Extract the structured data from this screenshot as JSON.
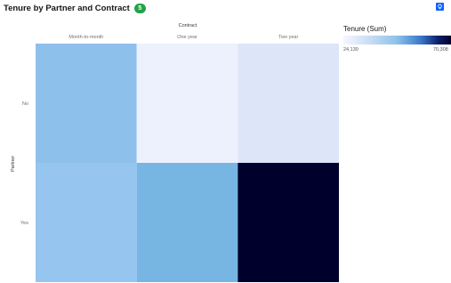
{
  "header": {
    "title": "Tenure by Partner and Contract",
    "badge": "5"
  },
  "legend": {
    "title": "Tenure (Sum)",
    "min_label": "24,130",
    "max_label": "70,308",
    "min_color": "#f6f7ff",
    "max_color": "#00002c"
  },
  "chart_data": {
    "type": "heatmap",
    "xlabel": "Contract",
    "ylabel": "Partner",
    "x_categories": [
      "Month-to-month",
      "One year",
      "Two year"
    ],
    "y_categories": [
      "No",
      "Yes"
    ],
    "values": [
      [
        52000,
        24130,
        31000
      ],
      [
        48000,
        55000,
        70308
      ]
    ],
    "cell_colors": [
      [
        "#8ec0ec",
        "#edf0fd",
        "#dde5f8"
      ],
      [
        "#96c5ef",
        "#77b5e3",
        "#00002c"
      ]
    ],
    "color_scale": {
      "label": "Tenure (Sum)",
      "range": [
        24130,
        70308
      ]
    }
  }
}
